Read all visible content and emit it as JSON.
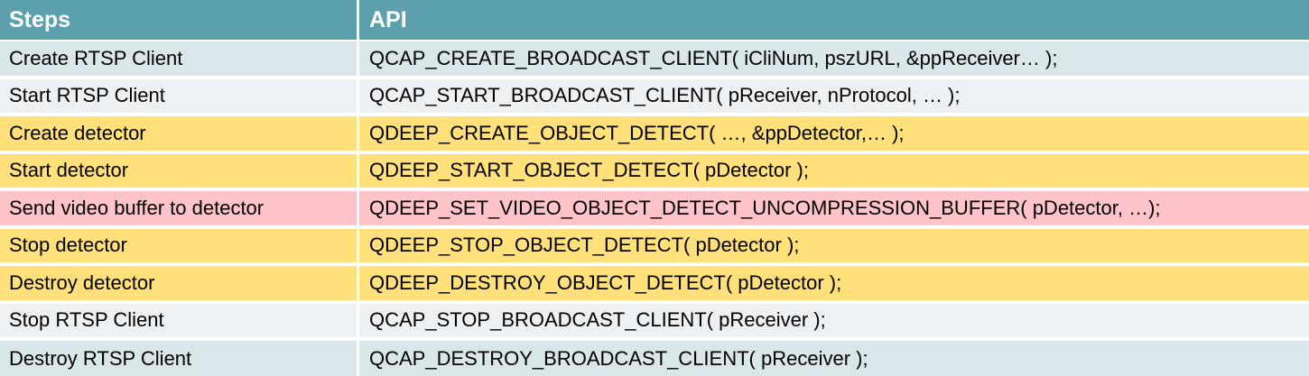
{
  "header": {
    "steps": "Steps",
    "api": "API"
  },
  "colors": {
    "header_bg": "#5c9fad",
    "rtsp_row_bg_a": "#d9e6ea",
    "rtsp_row_bg_b": "#edf1f3",
    "detector_row_bg": "#ffe07a",
    "send_buffer_row_bg": "#ffc4c9"
  },
  "rows": [
    {
      "step": "Create RTSP Client",
      "api": "QCAP_CREATE_BROADCAST_CLIENT( iCliNum, pszURL, &ppReceiver… );"
    },
    {
      "step": "Start RTSP Client",
      "api": "QCAP_START_BROADCAST_CLIENT( pReceiver, nProtocol, … );"
    },
    {
      "step": "Create detector",
      "api": "QDEEP_CREATE_OBJECT_DETECT( …, &ppDetector,… );"
    },
    {
      "step": "Start detector",
      "api": "QDEEP_START_OBJECT_DETECT( pDetector );"
    },
    {
      "step": "Send video buffer to detector",
      "api": "QDEEP_SET_VIDEO_OBJECT_DETECT_UNCOMPRESSION_BUFFER( pDetector, …);"
    },
    {
      "step": "Stop detector",
      "api": "QDEEP_STOP_OBJECT_DETECT( pDetector );"
    },
    {
      "step": "Destroy detector",
      "api": "QDEEP_DESTROY_OBJECT_DETECT( pDetector );"
    },
    {
      "step": "Stop RTSP Client",
      "api": "QCAP_STOP_BROADCAST_CLIENT( pReceiver );"
    },
    {
      "step": "Destroy RTSP Client",
      "api": "QCAP_DESTROY_BROADCAST_CLIENT( pReceiver );"
    }
  ]
}
